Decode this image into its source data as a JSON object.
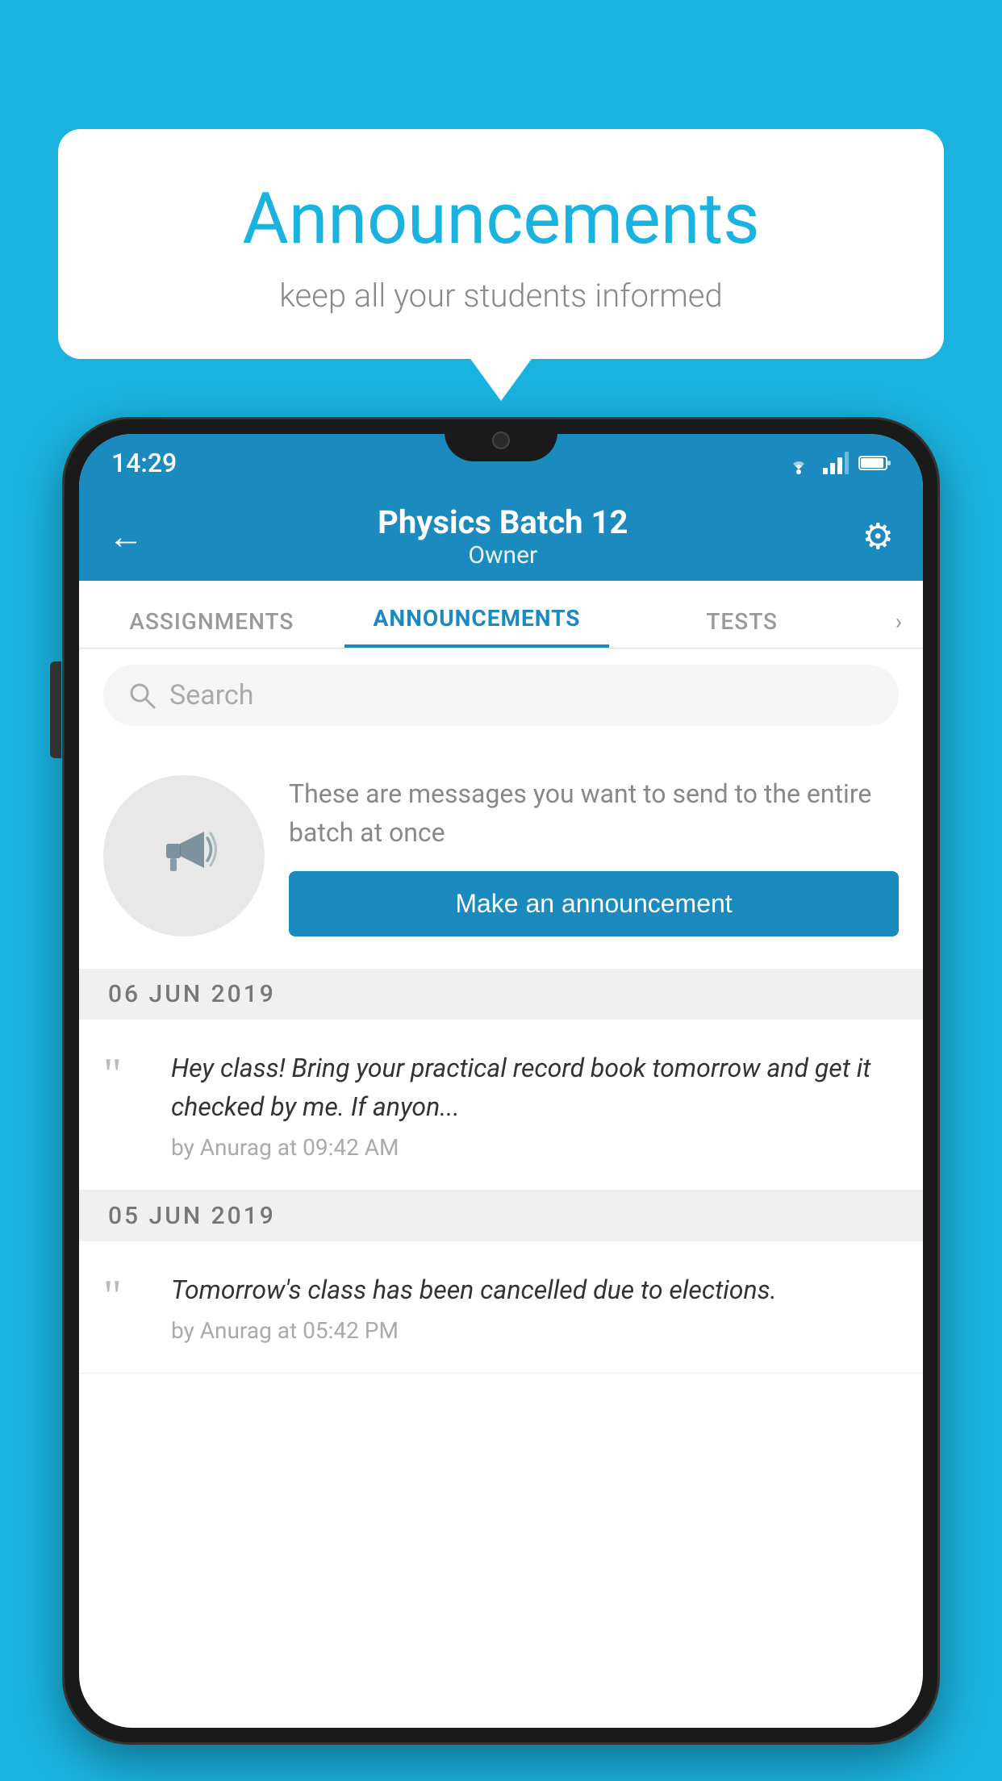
{
  "page": {
    "background_color": "#1ab3e0"
  },
  "speech_bubble": {
    "title": "Announcements",
    "subtitle": "keep all your students informed"
  },
  "status_bar": {
    "time": "14:29"
  },
  "app_bar": {
    "title": "Physics Batch 12",
    "subtitle": "Owner",
    "back_label": "←"
  },
  "tabs": [
    {
      "label": "ASSIGNMENTS",
      "active": false
    },
    {
      "label": "ANNOUNCEMENTS",
      "active": true
    },
    {
      "label": "TESTS",
      "active": false
    }
  ],
  "search": {
    "placeholder": "Search"
  },
  "announcement_section": {
    "description": "These are messages you want to send to the entire batch at once",
    "button_label": "Make an announcement"
  },
  "announcements": [
    {
      "date": "06  JUN  2019",
      "text": "Hey class! Bring your practical record book tomorrow and get it checked by me. If anyon...",
      "meta": "by Anurag at 09:42 AM"
    },
    {
      "date": "05  JUN  2019",
      "text": "Tomorrow's class has been cancelled due to elections.",
      "meta": "by Anurag at 05:42 PM"
    }
  ]
}
